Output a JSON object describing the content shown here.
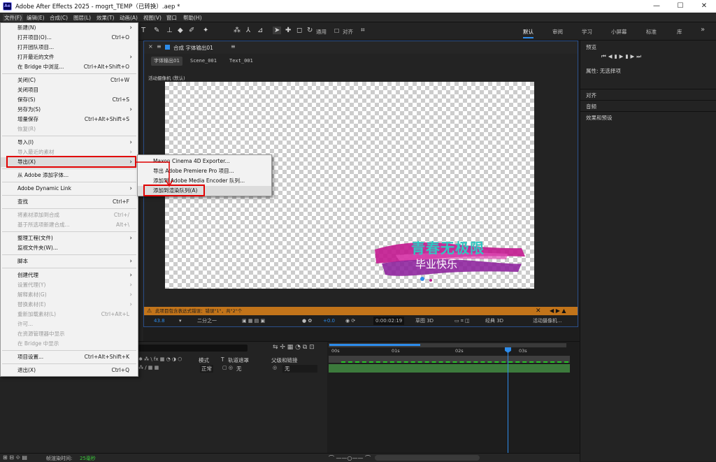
{
  "window": {
    "title": "Adobe After Effects 2025 - mogrt_TEMP（已转换）.aep *",
    "logo": "Ae",
    "minimize": "—",
    "maximize": "☐",
    "close": "✕"
  },
  "menubar": [
    "文件(F)",
    "编辑(E)",
    "合成(C)",
    "图层(L)",
    "效果(T)",
    "动画(A)",
    "视图(V)",
    "窗口",
    "帮助(H)"
  ],
  "toolbar": {
    "snap_label": "通用",
    "align_label": "对齐",
    "workspaces": [
      "默认",
      "审阅",
      "学习",
      "小屏幕",
      "标准",
      "库"
    ],
    "more": "»"
  },
  "file_menu": {
    "items": [
      {
        "label": "新建(N)",
        "shortcut": "",
        "arrow": true,
        "disabled": false
      },
      {
        "label": "打开项目(O)...",
        "shortcut": "Ctrl+O",
        "arrow": false,
        "disabled": false
      },
      {
        "label": "打开团队项目...",
        "shortcut": "",
        "arrow": false,
        "disabled": false
      },
      {
        "label": "打开最近的文件",
        "shortcut": "",
        "arrow": true,
        "disabled": false
      },
      {
        "label": "在 Bridge 中浏览...",
        "shortcut": "Ctrl+Alt+Shift+O",
        "arrow": false,
        "disabled": false
      },
      {
        "label": "关闭(C)",
        "shortcut": "Ctrl+W",
        "arrow": false,
        "disabled": false
      },
      {
        "label": "关闭项目",
        "shortcut": "",
        "arrow": false,
        "disabled": false
      },
      {
        "label": "保存(S)",
        "shortcut": "Ctrl+S",
        "arrow": false,
        "disabled": false
      },
      {
        "label": "另存为(S)",
        "shortcut": "",
        "arrow": true,
        "disabled": false
      },
      {
        "label": "增量保存",
        "shortcut": "Ctrl+Alt+Shift+S",
        "arrow": false,
        "disabled": false
      },
      {
        "label": "恢复(R)",
        "shortcut": "",
        "arrow": false,
        "disabled": true
      },
      {
        "label": "导入(I)",
        "shortcut": "",
        "arrow": true,
        "disabled": false
      },
      {
        "label": "导入最近的素材",
        "shortcut": "",
        "arrow": true,
        "disabled": true
      },
      {
        "label": "导出(X)",
        "shortcut": "",
        "arrow": true,
        "disabled": false
      },
      {
        "label": "从 Adobe 添加字体...",
        "shortcut": "",
        "arrow": false,
        "disabled": false
      },
      {
        "label": "Adobe Dynamic Link",
        "shortcut": "",
        "arrow": true,
        "disabled": false
      },
      {
        "label": "查找",
        "shortcut": "Ctrl+F",
        "arrow": false,
        "disabled": false
      },
      {
        "label": "将素材添加到合成",
        "shortcut": "Ctrl+/",
        "arrow": false,
        "disabled": true
      },
      {
        "label": "基于所选项新建合成...",
        "shortcut": "Alt+\\",
        "arrow": false,
        "disabled": true
      },
      {
        "label": "整理工程(文件)",
        "shortcut": "",
        "arrow": true,
        "disabled": false
      },
      {
        "label": "监视文件夹(W)...",
        "shortcut": "",
        "arrow": false,
        "disabled": false
      },
      {
        "label": "脚本",
        "shortcut": "",
        "arrow": true,
        "disabled": false
      },
      {
        "label": "创建代理",
        "shortcut": "",
        "arrow": true,
        "disabled": false
      },
      {
        "label": "设置代理(Y)",
        "shortcut": "",
        "arrow": true,
        "disabled": true
      },
      {
        "label": "解释素材(G)",
        "shortcut": "",
        "arrow": true,
        "disabled": true
      },
      {
        "label": "替换素材(E)",
        "shortcut": "",
        "arrow": true,
        "disabled": true
      },
      {
        "label": "重新加载素材(L)",
        "shortcut": "Ctrl+Alt+L",
        "arrow": false,
        "disabled": true
      },
      {
        "label": "许可...",
        "shortcut": "",
        "arrow": false,
        "disabled": true
      },
      {
        "label": "在资源管理器中显示",
        "shortcut": "",
        "arrow": false,
        "disabled": true
      },
      {
        "label": "在 Bridge 中显示",
        "shortcut": "",
        "arrow": false,
        "disabled": true
      },
      {
        "label": "项目设置...",
        "shortcut": "Ctrl+Alt+Shift+K",
        "arrow": false,
        "disabled": false
      },
      {
        "label": "退出(X)",
        "shortcut": "Ctrl+Q",
        "arrow": false,
        "disabled": false
      }
    ]
  },
  "export_submenu": {
    "items": [
      "Maxon Cinema 4D Exporter...",
      "导出 Adobe Premiere Pro 项目...",
      "添加到 Adobe Media Encoder 队列...",
      "添加到渲染队列(A)"
    ]
  },
  "composition": {
    "panel_label": "合成 字体输出01",
    "menu_icon": "≡",
    "close_icon": "×",
    "breadcrumbs": [
      "字体输出01",
      "Scene_001",
      "Text_001"
    ],
    "active_camera": "活动摄像机 (默认)",
    "graphic_line1": "青春无极限",
    "graphic_line2": "毕业快乐",
    "warning_text": "此项目包含表达式错误：错误\"1\"，共\"2\"个",
    "zoom": "43.8",
    "resolution": "二分之一",
    "exposure": "+0.0",
    "timecode": "0:00:02:19",
    "draft3d": "草图 3D",
    "renderer": "经典 3D",
    "camera": "活动摄像机..."
  },
  "right_panel": {
    "preview": "预览",
    "properties": "属性: 无选择项",
    "align": "对齐",
    "audio": "音频",
    "effects": "效果和预设"
  },
  "timeline": {
    "col_mode": "模式",
    "col_t": "T",
    "col_trkmat": "轨道遮罩",
    "col_parent": "父级和链接",
    "mode_value": "正常",
    "trkmat_value": "无",
    "parent_value": "无",
    "ruler": [
      "00s",
      "01s",
      "02s",
      "03s"
    ],
    "frame_render_label": "帧渲染时间:",
    "frame_render_value": "25毫秒"
  },
  "colors": {
    "accent_blue": "#2d8ceb",
    "highlight_red": "#e00000",
    "warning_orange": "#c2741a",
    "brush_magenta": "#c2188f",
    "text_teal": "#30c6c0"
  }
}
